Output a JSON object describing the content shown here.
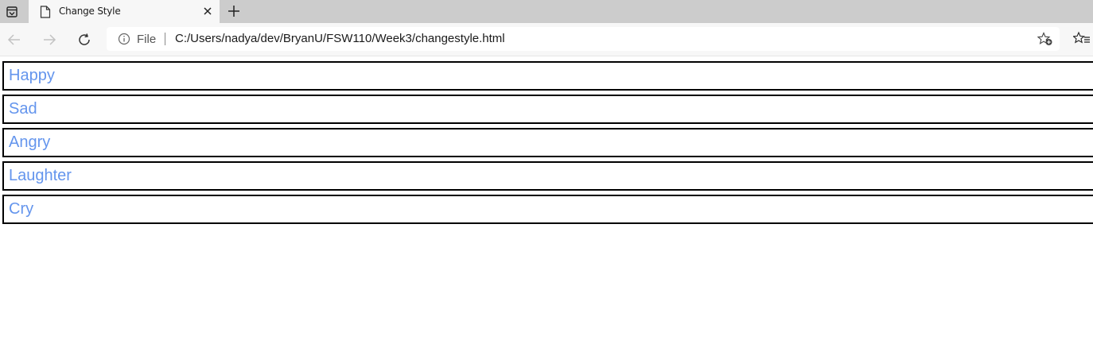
{
  "browser": {
    "tab": {
      "title": "Change Style"
    },
    "address_bar": {
      "scheme_label": "File",
      "url": "C:/Users/nadya/dev/BryanU/FSW110/Week3/changestyle.html"
    },
    "icons": [
      "tab-actions-icon",
      "page-icon",
      "close-icon",
      "plus-icon",
      "back-arrow-icon",
      "forward-arrow-icon",
      "reload-icon",
      "info-icon",
      "add-favorite-icon",
      "favorites-icon"
    ]
  },
  "page": {
    "moods": [
      "Happy",
      "Sad",
      "Angry",
      "Laughter",
      "Cry"
    ],
    "colors": {
      "label": "#6495ed",
      "border": "#000000"
    }
  }
}
